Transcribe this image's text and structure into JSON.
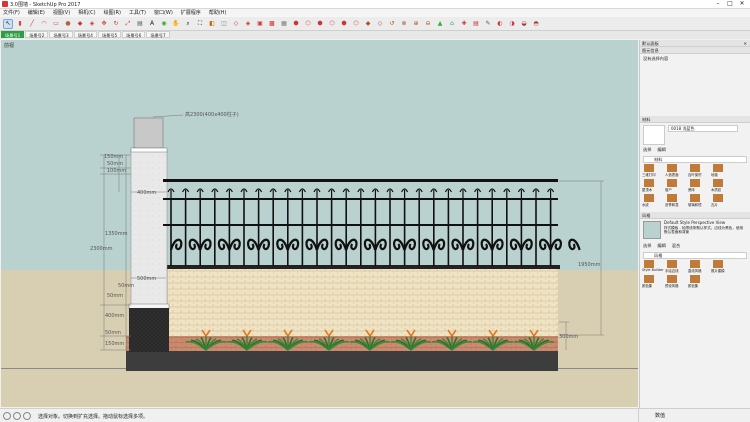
{
  "window": {
    "title": "3.0围墙 - SketchUp Pro 2017"
  },
  "menu": [
    "文件(F)",
    "编辑(E)",
    "视图(V)",
    "相机(C)",
    "绘图(R)",
    "工具(T)",
    "窗口(W)",
    "扩展程序",
    "帮助(H)"
  ],
  "scene_tabs": [
    "场景号1",
    "场景号2",
    "场景号3",
    "场景号4",
    "场景号5",
    "场景号6",
    "场景号7"
  ],
  "viewport": {
    "label": "前视",
    "dims": {
      "pillar_note": "高2300(400x400柱子)",
      "d150_top": "150mm",
      "d50_top": "50mm",
      "d100": "100mm",
      "d400_top": "400mm",
      "d1350": "1350mm",
      "d2300": "2300mm",
      "d50_a": "50mm",
      "d500": "500mm",
      "d50_b": "50mm",
      "d400_bot": "400mm",
      "d50_c": "50mm",
      "d150_bot": "150mm",
      "d1950": "1950mm",
      "d300": "300mm"
    }
  },
  "status": {
    "text": "选择对象。切换到扩充选择。拖动鼠标选择多项。",
    "measure_label": "数值"
  },
  "tray": {
    "title": "默认面板",
    "entity_info": {
      "header": "图元信息",
      "value": "没有选择内容"
    },
    "materials": {
      "header": "材料",
      "current": "0018 浅蓝色",
      "tabs": [
        "选择",
        "编辑"
      ],
      "library": "材料",
      "items": [
        "三维打印",
        "人造表面",
        "百叶窗帘",
        "地毯",
        "屋顶木",
        "窗户",
        "瓷砖",
        "木质纹",
        "水纹",
        "沥青和混",
        "玻璃和镜",
        "瓦片"
      ]
    },
    "styles": {
      "header": "风格",
      "style_name": "Default Style Perspective View",
      "style_desc": "样式模板 - 轮廓线条默认样式。边线为黑色，使用默认表面和背景",
      "tabs": [
        "选择",
        "编辑",
        "混合"
      ],
      "library": "风格",
      "items": [
        "Style Builder",
        "手绘边线",
        "直线风格",
        "照片建模",
        "颜色集",
        "预设风格",
        "颜色集"
      ]
    }
  },
  "colors": {
    "accent": "#2e9e44",
    "sky": "#b9d2cf",
    "ground": "#d8cfb2"
  }
}
